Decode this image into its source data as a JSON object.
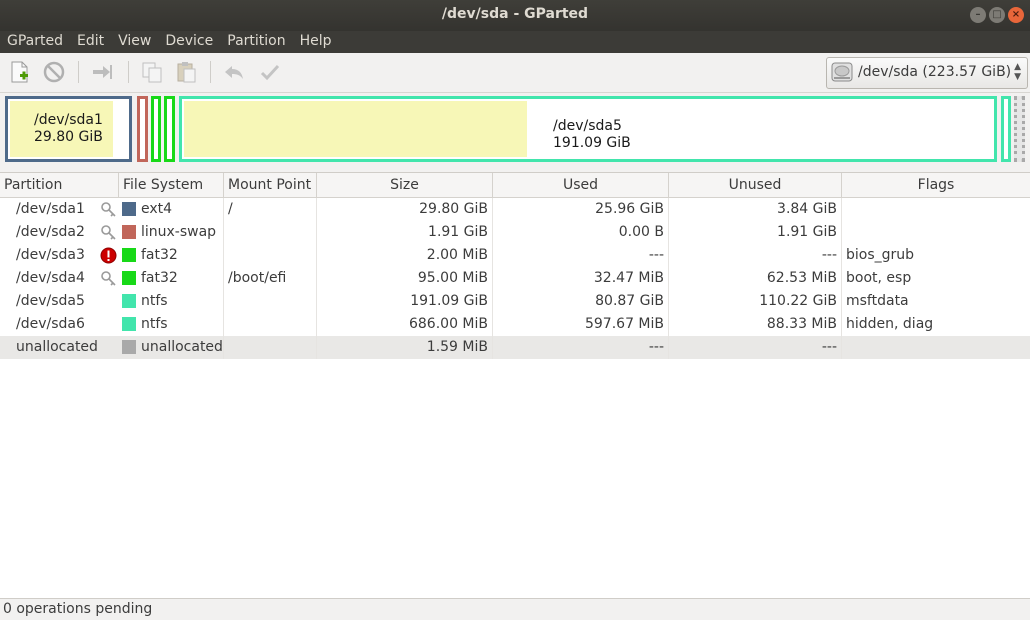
{
  "window": {
    "title": "/dev/sda - GParted"
  },
  "menu": [
    "GParted",
    "Edit",
    "View",
    "Device",
    "Partition",
    "Help"
  ],
  "toolbar": {
    "icons": [
      "new-partition-icon",
      "delete-icon",
      "resize-move-icon",
      "copy-icon",
      "paste-icon",
      "undo-icon",
      "apply-icon"
    ],
    "device_label": "/dev/sda  (223.57 GiB)"
  },
  "graph": {
    "sda1_name": "/dev/sda1",
    "sda1_size": "29.80 GiB",
    "sda5_name": "/dev/sda5",
    "sda5_size": "191.09 GiB"
  },
  "columns": [
    "Partition",
    "File System",
    "Mount Point",
    "Size",
    "Used",
    "Unused",
    "Flags"
  ],
  "rows": [
    {
      "partition": "/dev/sda1",
      "status_icon": "key-icon",
      "fs": "ext4",
      "fs_color": "#4e6a8a",
      "mount": "/",
      "size": "29.80 GiB",
      "used": "25.96 GiB",
      "unused": "3.84 GiB",
      "flags": ""
    },
    {
      "partition": "/dev/sda2",
      "status_icon": "key-icon",
      "fs": "linux-swap",
      "fs_color": "#c1665a",
      "mount": "",
      "size": "1.91 GiB",
      "used": "0.00 B",
      "unused": "1.91 GiB",
      "flags": ""
    },
    {
      "partition": "/dev/sda3",
      "status_icon": "error-icon",
      "fs": "fat32",
      "fs_color": "#18d918",
      "mount": "",
      "size": "2.00 MiB",
      "used": "---",
      "unused": "---",
      "flags": "bios_grub"
    },
    {
      "partition": "/dev/sda4",
      "status_icon": "key-icon",
      "fs": "fat32",
      "fs_color": "#18d918",
      "mount": "/boot/efi",
      "size": "95.00 MiB",
      "used": "32.47 MiB",
      "unused": "62.53 MiB",
      "flags": "boot, esp"
    },
    {
      "partition": "/dev/sda5",
      "status_icon": "",
      "fs": "ntfs",
      "fs_color": "#42e5ac",
      "mount": "",
      "size": "191.09 GiB",
      "used": "80.87 GiB",
      "unused": "110.22 GiB",
      "flags": "msftdata"
    },
    {
      "partition": "/dev/sda6",
      "status_icon": "",
      "fs": "ntfs",
      "fs_color": "#42e5ac",
      "mount": "",
      "size": "686.00 MiB",
      "used": "597.67 MiB",
      "unused": "88.33 MiB",
      "flags": "hidden, diag"
    },
    {
      "partition": "unallocated",
      "status_icon": "",
      "fs": "unallocated",
      "fs_color": "#a9a9a9",
      "mount": "",
      "size": "1.59 MiB",
      "used": "---",
      "unused": "---",
      "flags": ""
    }
  ],
  "status": {
    "text": "0 operations pending"
  }
}
